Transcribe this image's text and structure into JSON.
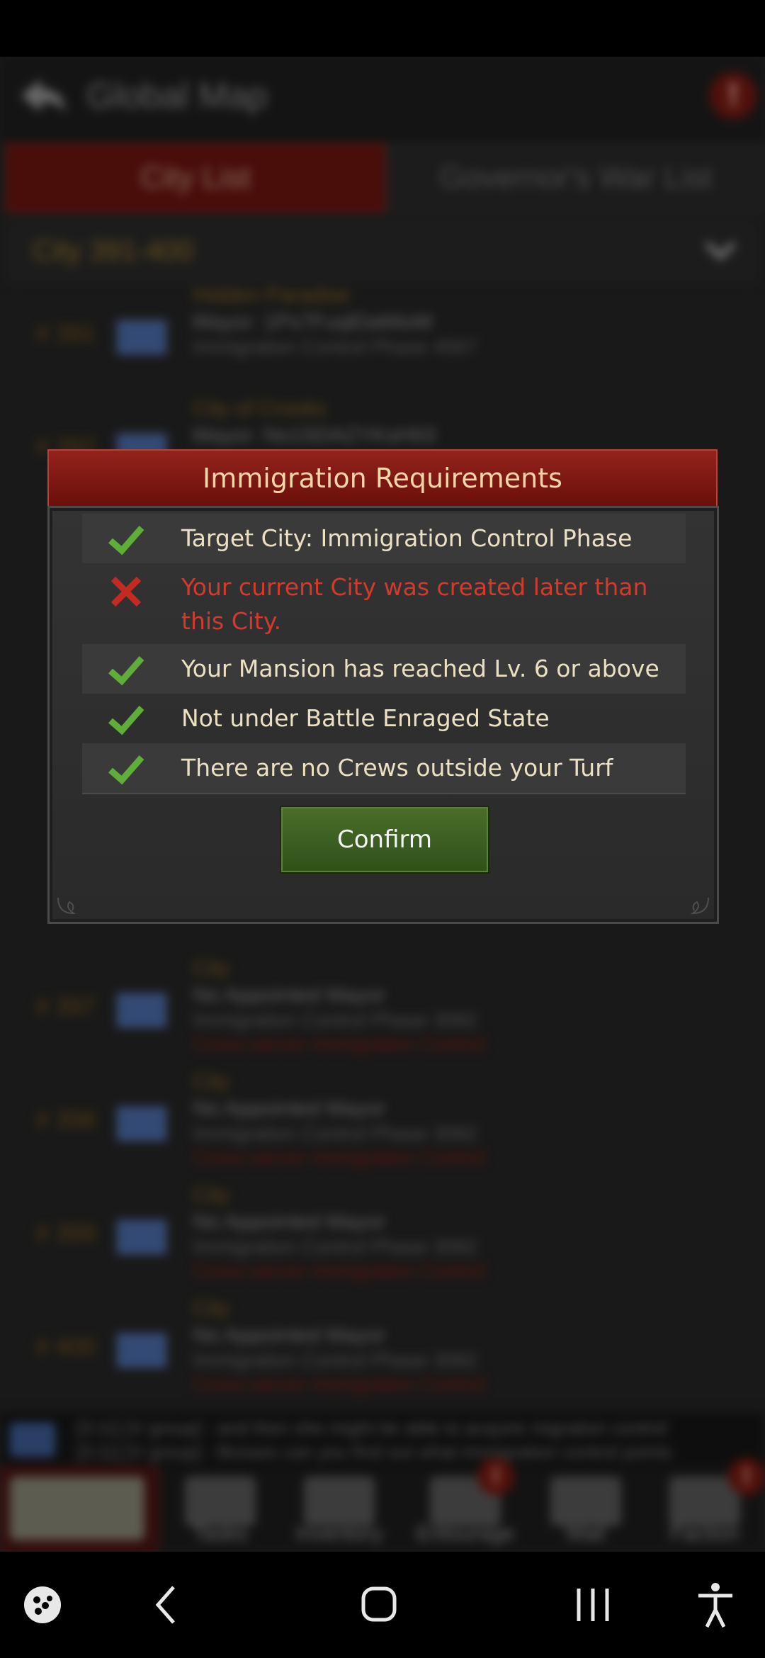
{
  "header": {
    "title": "Global Map"
  },
  "tabs": [
    {
      "label": "City List"
    },
    {
      "label": "Governor's War List"
    }
  ],
  "range_selector": {
    "label": "City 391-400"
  },
  "city_list": [
    {
      "num": "# 391",
      "name": "Hidden Paradise",
      "mayor": "Mayor: 1Ps7FuqlDaMioM",
      "phase": "Immigration Control Phase 4567",
      "warn": ""
    },
    {
      "num": "# 392",
      "name": "City of Crooks",
      "mayor": "Mayor: Ns1SDAZYKsHIt3",
      "phase": "",
      "warn": ""
    },
    {
      "num": "# 397",
      "name": "City",
      "mayor": "No Appointed Mayor",
      "phase": "Immigration Control Phase 3082",
      "warn": "Cross-server Immigration Control"
    },
    {
      "num": "# 398",
      "name": "City",
      "mayor": "No Appointed Mayor",
      "phase": "Immigration Control Phase 3082",
      "warn": "Cross-server Immigration Control"
    },
    {
      "num": "# 399",
      "name": "City",
      "mayor": "No Appointed Mayor",
      "phase": "Immigration Control Phase 3082",
      "warn": "Cross-server Immigration Control"
    },
    {
      "num": "# 400",
      "name": "City",
      "mayor": "No Appointed Mayor",
      "phase": "Immigration Control Phase 3082",
      "warn": "Cross-server Immigration Control"
    }
  ],
  "ticker": {
    "line1": "[3:11] [V group] - and then she might be able to acquire migration control",
    "line2": "[3:11] [V group] - Bosses can you find out what immigration control points"
  },
  "bottom_nav": [
    {
      "label": ""
    },
    {
      "label": "Tasks"
    },
    {
      "label": "Inventory"
    },
    {
      "label": "Entourage"
    },
    {
      "label": "Mail"
    },
    {
      "label": "Faction"
    }
  ],
  "modal": {
    "title": "Immigration Requirements",
    "requirements": [
      {
        "text": "Target City: Immigration Control Phase",
        "status": "met"
      },
      {
        "text": "Your current City was created later than this City.",
        "status": "unmet"
      },
      {
        "text": "Your Mansion has reached Lv. 6 or above",
        "status": "met"
      },
      {
        "text": "Not under Battle Enraged State",
        "status": "met"
      },
      {
        "text": "There are no Crews outside your Turf",
        "status": "met"
      }
    ],
    "confirm_label": "Confirm"
  },
  "colors": {
    "met": "#5fae3a",
    "unmet": "#c42a22",
    "header_red": "#7a1912",
    "confirm_green": "#3e6224"
  },
  "icons": [
    "back-arrow-icon",
    "alert-icon",
    "chevron-down-icon",
    "check-icon",
    "cross-icon",
    "game-launcher-icon",
    "back-icon",
    "home-icon",
    "recents-icon",
    "accessibility-icon"
  ]
}
